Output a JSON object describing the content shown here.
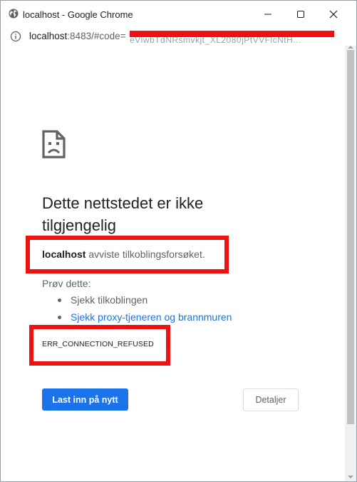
{
  "window": {
    "title": "localhost - Google Chrome"
  },
  "addressbar": {
    "url_prefix": "localhost",
    "url_suffix": ":8483/#code=",
    "url_hidden": "eVlwbTdNRsmvkjt_XL2080jPtVVFlcNtH..."
  },
  "error_page": {
    "heading": "Dette nettstedet er ikke tilgjengelig",
    "host": "localhost",
    "message": " avviste tilkoblingsforsøket.",
    "try_label": "Prøv dette:",
    "suggestions": [
      "Sjekk tilkoblingen",
      "Sjekk proxy-tjeneren og brannmuren"
    ],
    "error_code": "ERR_CONNECTION_REFUSED",
    "reload_button": "Last inn på nytt",
    "details_button": "Detaljer"
  },
  "colors": {
    "accent": "#1a73e8",
    "redaction": "#ee1111"
  },
  "icons": [
    "globe-icon",
    "minimize-icon",
    "maximize-icon",
    "close-icon",
    "info-icon",
    "sad-page-icon"
  ]
}
